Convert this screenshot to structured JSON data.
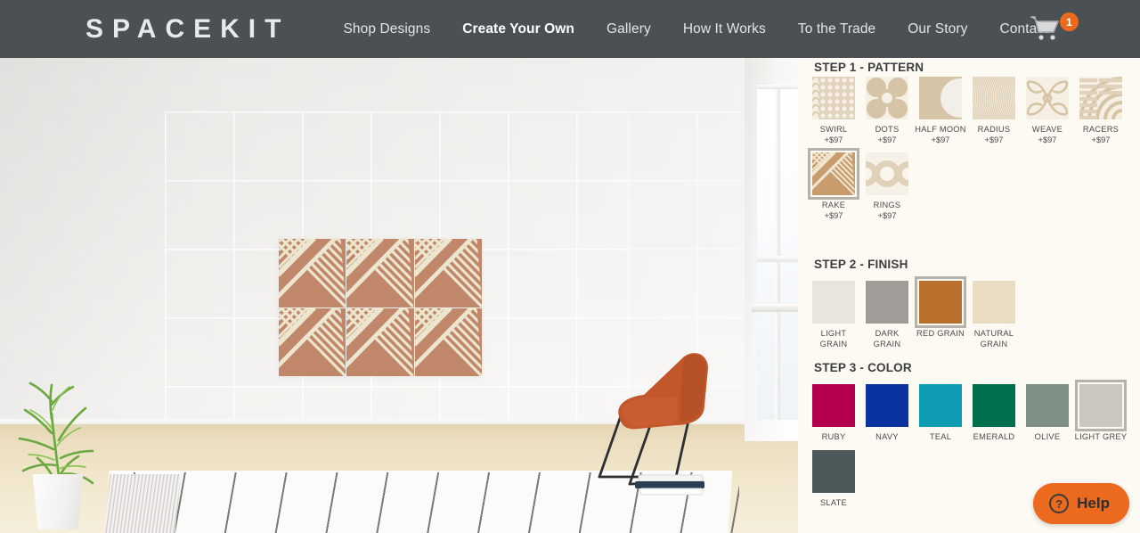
{
  "nav": {
    "brand": "SPACEKIT",
    "links": [
      {
        "label": "Shop Designs",
        "active": false
      },
      {
        "label": "Create Your Own",
        "active": true
      },
      {
        "label": "Gallery",
        "active": false
      },
      {
        "label": "How It Works",
        "active": false
      },
      {
        "label": "To the Trade",
        "active": false
      },
      {
        "label": "Our Story",
        "active": false
      },
      {
        "label": "Contact",
        "active": false
      }
    ],
    "cart": {
      "icon": "shopping-cart-icon",
      "badge_count": "1",
      "badge_color": "#ec6a1e"
    }
  },
  "scene": {
    "description": "room-preview",
    "tile_color": "#c0876a",
    "tile_pattern": "rake",
    "tile_columns": 3,
    "tile_rows": 2
  },
  "panel": {
    "step1": {
      "title": "STEP 1 - PATTERN",
      "options": [
        {
          "label": "SWIRL",
          "price": "+$97",
          "pattern": "swirl",
          "selected": false
        },
        {
          "label": "DOTS",
          "price": "+$97",
          "pattern": "dots",
          "selected": false
        },
        {
          "label": "HALF MOON",
          "price": "+$97",
          "pattern": "halfmoon",
          "selected": false
        },
        {
          "label": "RADIUS",
          "price": "+$97",
          "pattern": "radius",
          "selected": false
        },
        {
          "label": "WEAVE",
          "price": "+$97",
          "pattern": "weave",
          "selected": false
        },
        {
          "label": "RACERS",
          "price": "+$97",
          "pattern": "racers",
          "selected": false
        },
        {
          "label": "RAKE",
          "price": "+$97",
          "pattern": "rake",
          "selected": true
        },
        {
          "label": "RINGS",
          "price": "+$97",
          "pattern": "rings",
          "selected": false
        }
      ]
    },
    "step2": {
      "title": "STEP 2 - FINISH",
      "options": [
        {
          "label": "LIGHT GRAIN",
          "color": "#eae5dc",
          "selected": false
        },
        {
          "label": "DARK GRAIN",
          "color": "#a09c97",
          "selected": false
        },
        {
          "label": "RED GRAIN",
          "color": "#b9702c",
          "selected": true
        },
        {
          "label": "NATURAL GRAIN",
          "color": "#e9dcc3",
          "selected": false
        }
      ]
    },
    "step3": {
      "title": "STEP 3 - COLOR",
      "options": [
        {
          "label": "RUBY",
          "color": "#b00council",
          "selected": false
        },
        {
          "label": "NAVY",
          "color": "#0a33a0",
          "selected": false
        },
        {
          "label": "TEAL",
          "color": "#0d9cb4",
          "selected": false
        },
        {
          "label": "EMERALD",
          "color": "#00704f",
          "selected": false
        },
        {
          "label": "OLIVE",
          "color": "#7e9085",
          "selected": false
        },
        {
          "label": "LIGHT GREY",
          "color": "#cbc7bf",
          "selected": true
        },
        {
          "label": "SLATE",
          "color": "#4d585b",
          "selected": false
        }
      ]
    }
  },
  "help": {
    "label": "Help",
    "icon": "question-circle-icon",
    "color": "#ec6a1e"
  }
}
